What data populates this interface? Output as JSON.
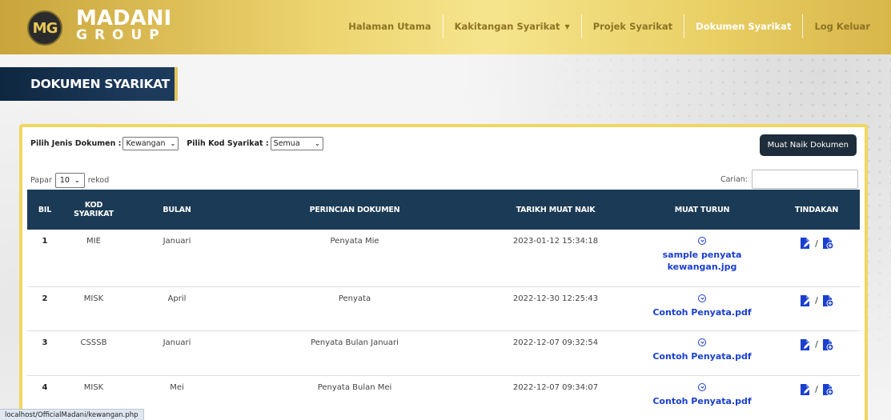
{
  "brand": {
    "logo_initials": "MG",
    "name": "MADANI",
    "sub": "GROUP"
  },
  "nav": {
    "items": [
      {
        "label": "Halaman Utama"
      },
      {
        "label": "Kakitangan Syarikat",
        "dropdown": true
      },
      {
        "label": "Projek Syarikat"
      },
      {
        "label": "Dokumen Syarikat",
        "active": true
      },
      {
        "label": "Log Keluar"
      }
    ]
  },
  "page_title": "DOKUMEN SYARIKAT",
  "filters": {
    "doc_type_label": "Pilih Jenis Dokumen :",
    "doc_type_value": "Kewangan",
    "company_label": "Pilih Kod Syarikat :",
    "company_value": "Semua"
  },
  "upload_button": "Muat Naik Dokumen",
  "length": {
    "prefix": "Papar",
    "value": "10",
    "suffix": "rekod"
  },
  "search_label": "Carian:",
  "table": {
    "headers": {
      "bil": "BIL",
      "kod_1": "KOD",
      "kod_2": "SYARIKAT",
      "bulan": "BULAN",
      "perincian": "PERINCIAN DOKUMEN",
      "tarikh": "TARIKH MUAT NAIK",
      "muat_turun": "MUAT TURUN",
      "tindakan": "TINDAKAN"
    },
    "rows": [
      {
        "bil": "1",
        "kod": "MIE",
        "bulan": "Januari",
        "perincian": "Penyata Mie",
        "tarikh": "2023-01-12 15:34:18",
        "file_1": "sample penyata",
        "file_2": "kewangan.jpg"
      },
      {
        "bil": "2",
        "kod": "MISK",
        "bulan": "April",
        "perincian": "Penyata",
        "tarikh": "2022-12-30 12:25:43",
        "file_1": "Contoh Penyata.pdf",
        "file_2": ""
      },
      {
        "bil": "3",
        "kod": "CSSSB",
        "bulan": "Januari",
        "perincian": "Penyata Bulan Januari",
        "tarikh": "2022-12-07 09:32:54",
        "file_1": "Contoh Penyata.pdf",
        "file_2": ""
      },
      {
        "bil": "4",
        "kod": "MISK",
        "bulan": "Mei",
        "perincian": "Penyata Bulan Mei",
        "tarikh": "2022-12-07 09:34:07",
        "file_1": "Contoh Penyata.pdf",
        "file_2": ""
      }
    ],
    "action_separator": "/"
  },
  "status_url": "localhost/OfficialMadani/kewangan.php",
  "colors": {
    "navbar_gold": "#ecd36e",
    "header_navy": "#1b3a55",
    "link_blue": "#1a3fcf",
    "card_border": "#f0d760"
  }
}
